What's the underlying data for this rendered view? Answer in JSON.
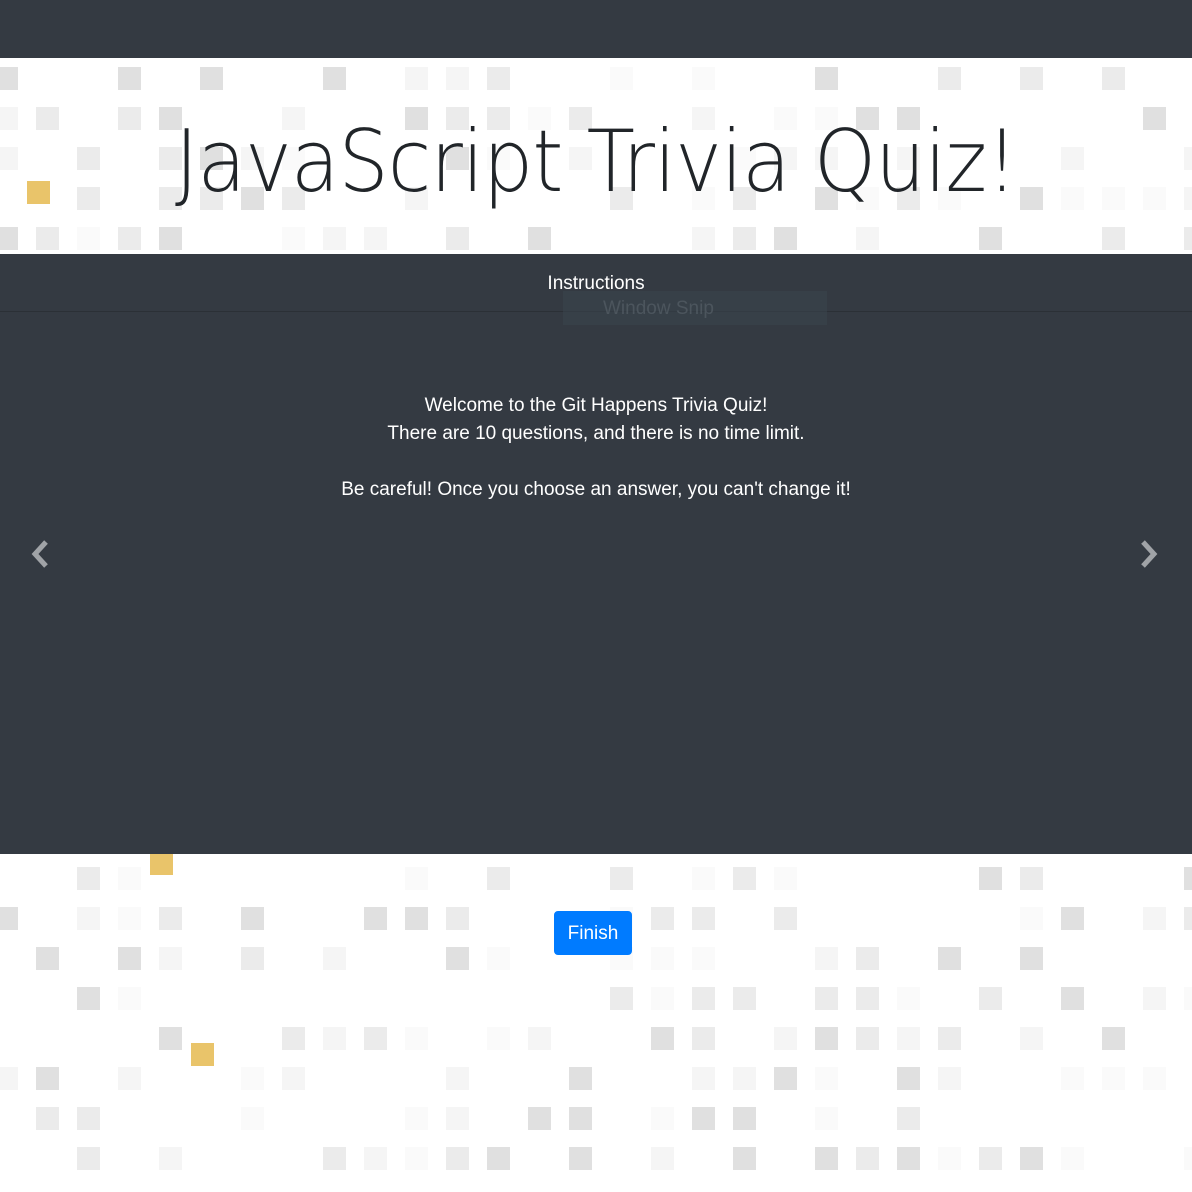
{
  "page": {
    "title": "JavaScript Trivia Quiz!"
  },
  "carousel": {
    "header": "Instructions",
    "ghost_overlay": "Window Snip",
    "body_lines": [
      "Welcome to the Git Happens Trivia Quiz!",
      "There are 10 questions, and there is no time limit.",
      "Be careful! Once you choose an answer, you can't change it!"
    ],
    "prev_icon": "chevron-left-icon",
    "next_icon": "chevron-right-icon"
  },
  "actions": {
    "finish_label": "Finish"
  },
  "colors": {
    "dark_panel": "#343a42",
    "primary": "#007bff",
    "accent_square": "#e9c46a",
    "pattern_light": "#f5f5f5",
    "pattern_mid": "#ebebeb",
    "pattern_dark": "#e0e0e0"
  }
}
